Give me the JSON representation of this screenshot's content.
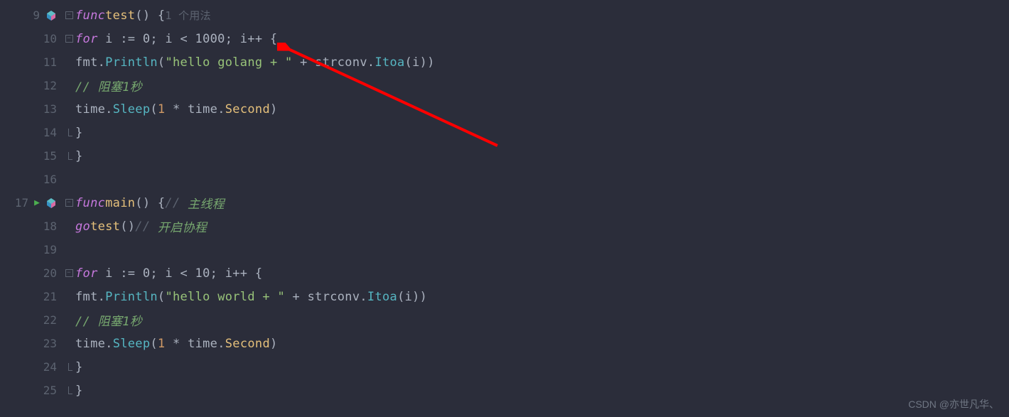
{
  "lineStart": 9,
  "code": {
    "l9": {
      "kw": "func",
      "name": "test",
      "brace": "() {",
      "hint": "1 个用法"
    },
    "l10": {
      "kw": "for",
      "body": " i := 0; i < 1000; i++ {"
    },
    "l11": {
      "pkg": "fmt",
      "fn": "Println",
      "str1": "\"hello golang + \"",
      "plus": " + ",
      "pkg2": "strconv",
      "fn2": "Itoa",
      "arg": "(i))"
    },
    "l12": {
      "comment": "// 阻塞1秒"
    },
    "l13": {
      "pkg": "time",
      "fn": "Sleep",
      "open": "(",
      "num": "1",
      "op": " * ",
      "pkg2": "time",
      "field": "Second",
      "close": ")"
    },
    "l14": {
      "brace": "}"
    },
    "l15": {
      "brace": "}"
    },
    "l17": {
      "kw": "func",
      "name": "main",
      "brace": "() {",
      "commentSlash": "//",
      "comment": " 主线程"
    },
    "l18": {
      "kw": "go",
      "fn": "test",
      "call": "()",
      "commentSlash": "//",
      "comment": " 开启协程"
    },
    "l20": {
      "kw": "for",
      "body": " i := 0; i < 10; i++ {"
    },
    "l21": {
      "pkg": "fmt",
      "fn": "Println",
      "str1": "\"hello world + \"",
      "plus": " + ",
      "pkg2": "strconv",
      "fn2": "Itoa",
      "arg": "(i))"
    },
    "l22": {
      "comment": "// 阻塞1秒"
    },
    "l23": {
      "pkg": "time",
      "fn": "Sleep",
      "open": "(",
      "num": "1",
      "op": " * ",
      "pkg2": "time",
      "field": "Second",
      "close": ")"
    },
    "l24": {
      "brace": "}"
    },
    "l25": {
      "brace": "}"
    }
  },
  "watermark": "CSDN @亦世凡华、",
  "annotations": {
    "arrow": {
      "color": "#ff0000"
    }
  }
}
